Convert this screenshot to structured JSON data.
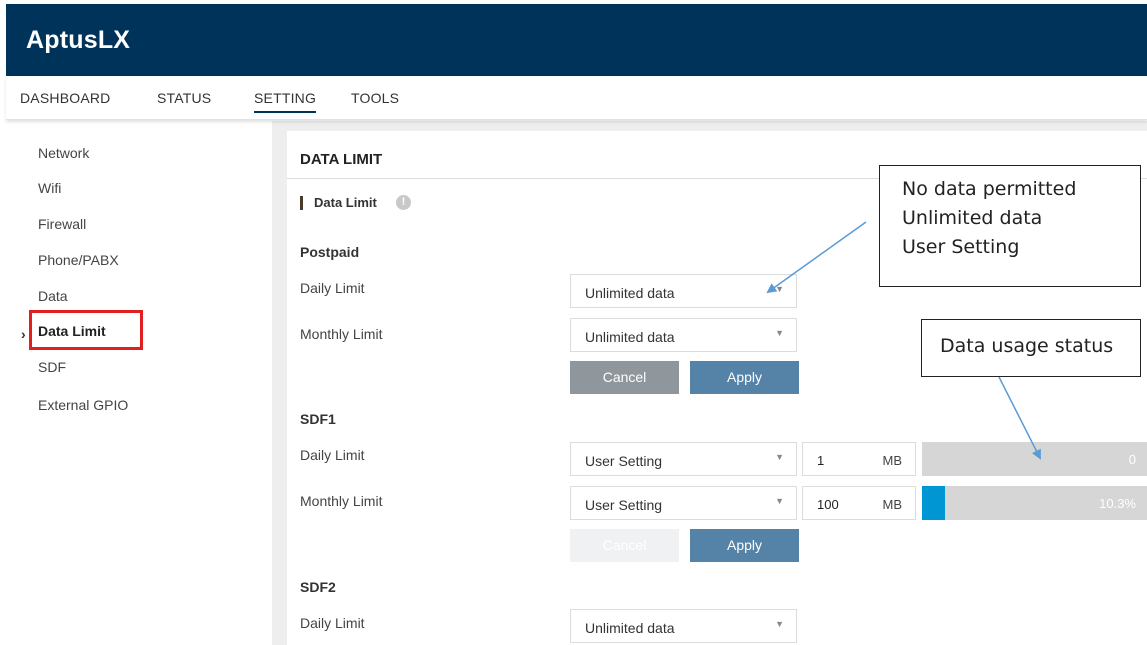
{
  "app": {
    "title": "AptusLX"
  },
  "nav": {
    "tabs": [
      {
        "label": "DASHBOARD"
      },
      {
        "label": "STATUS"
      },
      {
        "label": "SETTING",
        "active": true
      },
      {
        "label": "TOOLS"
      }
    ]
  },
  "sidebar": {
    "items": [
      {
        "label": "Network"
      },
      {
        "label": "Wifi"
      },
      {
        "label": "Firewall"
      },
      {
        "label": "Phone/PABX"
      },
      {
        "label": "Data"
      },
      {
        "label": "Data Limit",
        "active": true
      },
      {
        "label": "SDF"
      },
      {
        "label": "External GPIO"
      }
    ],
    "active_marker": "›"
  },
  "panel": {
    "title": "DATA LIMIT",
    "section_label": "Data Limit",
    "info_icon": "!",
    "groups": {
      "postpaid": {
        "title": "Postpaid",
        "daily": {
          "label": "Daily Limit",
          "select": "Unlimited data"
        },
        "monthly": {
          "label": "Monthly Limit",
          "select": "Unlimited data"
        },
        "cancel": "Cancel",
        "apply": "Apply"
      },
      "sdf1": {
        "title": "SDF1",
        "daily": {
          "label": "Daily Limit",
          "select": "User Setting",
          "value": "1",
          "unit": "MB",
          "usage": "0",
          "usage_fraction": 0
        },
        "monthly": {
          "label": "Monthly Limit",
          "select": "User Setting",
          "value": "100",
          "unit": "MB",
          "usage": "10.3%",
          "usage_fraction": 0.103
        },
        "cancel": "Cancel",
        "apply": "Apply"
      },
      "sdf2": {
        "title": "SDF2",
        "daily": {
          "label": "Daily Limit",
          "select": "Unlimited data"
        }
      }
    }
  },
  "callouts": {
    "options": {
      "line1": "No data permitted",
      "line2": "Unlimited data",
      "line3": "User Setting"
    },
    "usage": {
      "text": "Data usage status"
    }
  },
  "colors": {
    "header_bg": "#00335a",
    "highlight": "#e02020",
    "apply_button": "#5583a8",
    "cancel_button": "#8f979d",
    "usage_fill": "#0096d3",
    "usage_track": "#d6d6d6",
    "arrow": "#5b9bd5"
  }
}
